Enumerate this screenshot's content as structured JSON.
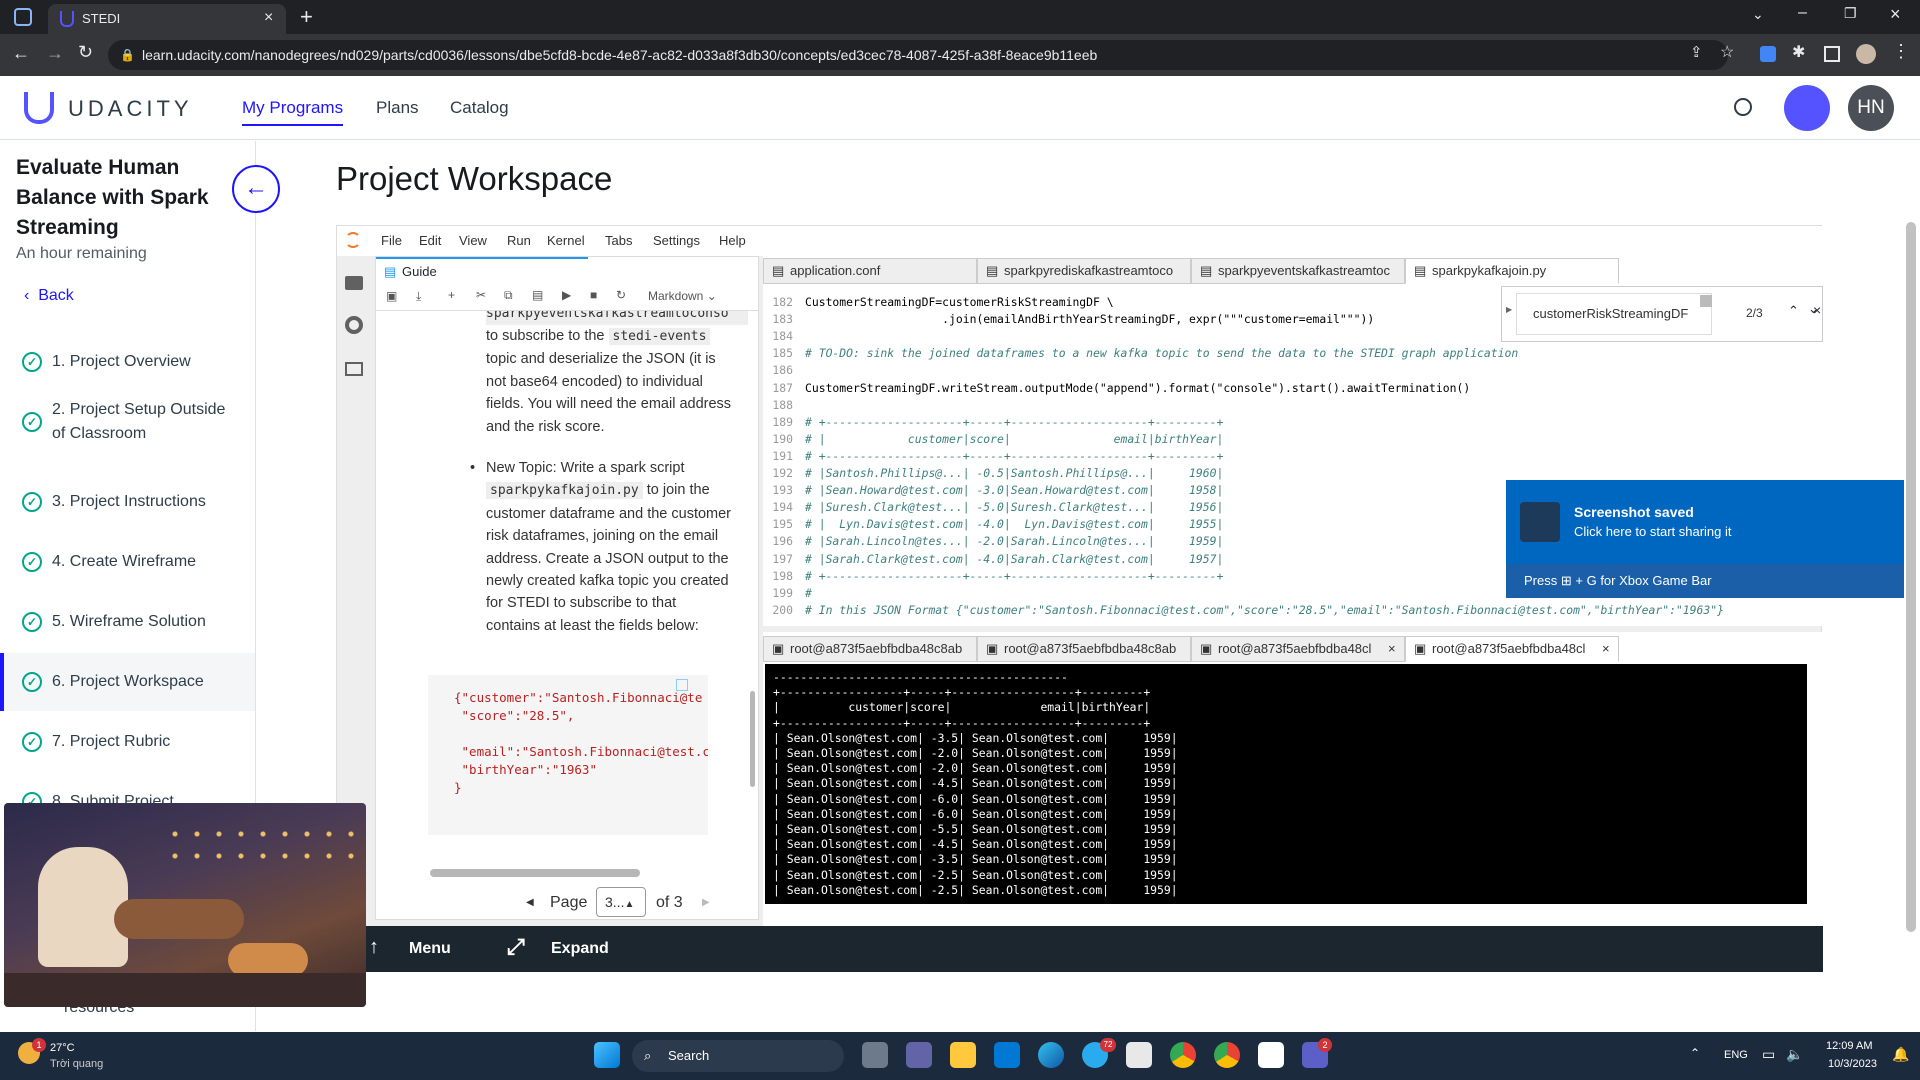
{
  "browser": {
    "tab_title": "STEDI",
    "url": "learn.udacity.com/nanodegrees/nd029/parts/cd0036/lessons/dbe5cfd8-bcde-4e87-ac82-d033a8f3db30/concepts/ed3cec78-4087-425f-a38f-8eace9b11eeb"
  },
  "header": {
    "logo": "UDACITY",
    "nav": [
      "My Programs",
      "Plans",
      "Catalog"
    ],
    "avatar_initials": "HN"
  },
  "sidebar": {
    "course_title": "Evaluate Human Balance with Spark Streaming",
    "time_remaining": "An hour remaining",
    "back": "Back",
    "items": [
      {
        "label": "1. Project Overview"
      },
      {
        "label": "2. Project Setup Outside of Classroom"
      },
      {
        "label": "3. Project Instructions"
      },
      {
        "label": "4. Create Wireframe"
      },
      {
        "label": "5. Wireframe Solution"
      },
      {
        "label": "6. Project Workspace"
      },
      {
        "label": "7. Project Rubric"
      },
      {
        "label": "8. Submit Project"
      }
    ],
    "resources": "resources"
  },
  "main": {
    "title": "Project Workspace"
  },
  "jupyter": {
    "menus": [
      "File",
      "Edit",
      "View",
      "Run",
      "Kernel",
      "Tabs",
      "Settings",
      "Help"
    ],
    "guide_tab": "Guide",
    "cell_type": "Markdown",
    "guide": {
      "line_partial": "sparkpyeventskafkastreamtoconso",
      "p1_a": "to subscribe to the",
      "p1_code": "stedi-events",
      "p1_b": "topic and deserialize the JSON (it is not base64 encoded) to individual fields. You will need the email address and the risk score.",
      "bullet_a": "New Topic: Write a spark script",
      "bullet_code": "sparkpykafkajoin.py",
      "bullet_b": "to join the customer dataframe and the customer risk dataframes, joining on the email address. Create a JSON output to the newly created kafka topic you created for STEDI to subscribe to that contains at least the fields below:",
      "json": "{\"customer\":\"Santosh.Fibonnaci@te\n \"score\":\"28.5\",\n\n \"email\":\"Santosh.Fibonnaci@test.c\n \"birthYear\":\"1963\"\n}"
    },
    "pager": {
      "label": "Page",
      "value": "3...",
      "of": "of 3"
    },
    "editor_tabs": [
      "application.conf",
      "sparkpyrediskafkastreamtoco",
      "sparkpyeventskafkastreamtoc",
      "sparkpykafkajoin.py"
    ],
    "find": {
      "query": "customerRiskStreamingDF",
      "count": "2/3"
    },
    "code_lines": [
      {
        "n": "182",
        "t": "CustomerStreamingDF=customerRiskStreamingDF \\"
      },
      {
        "n": "183",
        "t": "                    .join(emailAndBirthYearStreamingDF, expr(\"\"\"customer=email\"\"\"))"
      },
      {
        "n": "184",
        "t": ""
      },
      {
        "n": "185",
        "t": "# TO-DO: sink the joined dataframes to a new kafka topic to send the data to the STEDI graph application"
      },
      {
        "n": "186",
        "t": ""
      },
      {
        "n": "187",
        "t": "CustomerStreamingDF.writeStream.outputMode(\"append\").format(\"console\").start().awaitTermination()"
      },
      {
        "n": "188",
        "t": ""
      },
      {
        "n": "189",
        "t": "# +--------------------+-----+--------------------+---------+"
      },
      {
        "n": "190",
        "t": "# |            customer|score|               email|birthYear|"
      },
      {
        "n": "191",
        "t": "# +--------------------+-----+--------------------+---------+"
      },
      {
        "n": "192",
        "t": "# |Santosh.Phillips@...| -0.5|Santosh.Phillips@...|     1960|"
      },
      {
        "n": "193",
        "t": "# |Sean.Howard@test.com| -3.0|Sean.Howard@test.com|     1958|"
      },
      {
        "n": "194",
        "t": "# |Suresh.Clark@test...| -5.0|Suresh.Clark@test...|     1956|"
      },
      {
        "n": "195",
        "t": "# |  Lyn.Davis@test.com| -4.0|  Lyn.Davis@test.com|     1955|"
      },
      {
        "n": "196",
        "t": "# |Sarah.Lincoln@tes...| -2.0|Sarah.Lincoln@tes...|     1959|"
      },
      {
        "n": "197",
        "t": "# |Sarah.Clark@test.com| -4.0|Sarah.Clark@test.com|     1957|"
      },
      {
        "n": "198",
        "t": "# +--------------------+-----+--------------------+---------+"
      },
      {
        "n": "199",
        "t": "#"
      },
      {
        "n": "200",
        "t": "# In this JSON Format {\"customer\":\"Santosh.Fibonnaci@test.com\",\"score\":\"28.5\",\"email\":\"Santosh.Fibonnaci@test.com\",\"birthYear\":\"1963\"}"
      }
    ],
    "terminal_tabs": [
      "root@a873f5aebfbdba48c8ab",
      "root@a873f5aebfbdba48c8ab",
      "root@a873f5aebfbdba48cl",
      "root@a873f5aebfbdba48cl"
    ],
    "terminal_output": "-------------------------------------------\n+------------------+-----+------------------+---------+\n|          customer|score|             email|birthYear|\n+------------------+-----+------------------+---------+\n| Sean.Olson@test.com| -3.5| Sean.Olson@test.com|     1959|\n| Sean.Olson@test.com| -2.0| Sean.Olson@test.com|     1959|\n| Sean.Olson@test.com| -2.0| Sean.Olson@test.com|     1959|\n| Sean.Olson@test.com| -4.5| Sean.Olson@test.com|     1959|\n| Sean.Olson@test.com| -6.0| Sean.Olson@test.com|     1959|\n| Sean.Olson@test.com| -6.0| Sean.Olson@test.com|     1959|\n| Sean.Olson@test.com| -5.5| Sean.Olson@test.com|     1959|\n| Sean.Olson@test.com| -4.5| Sean.Olson@test.com|     1959|\n| Sean.Olson@test.com| -3.5| Sean.Olson@test.com|     1959|\n| Sean.Olson@test.com| -2.5| Sean.Olson@test.com|     1959|\n| Sean.Olson@test.com| -2.5| Sean.Olson@test.com|     1959|",
    "bottom": {
      "menu": "Menu",
      "expand": "Expand"
    }
  },
  "toast": {
    "title": "Screenshot saved",
    "subtitle": "Click here to start sharing it",
    "footer_a": "Press",
    "footer_b": "+ G for Xbox Game Bar"
  },
  "taskbar": {
    "weather_temp": "27°C",
    "weather_desc": "Trời quang",
    "weather_badge": "1",
    "search": "Search",
    "lang": "ENG",
    "time": "12:09 AM",
    "date": "10/3/2023",
    "badges": [
      "72",
      "2"
    ]
  },
  "colors": {
    "accent": "#02b3e4",
    "brand_purple": "#5553ff",
    "check_green": "#02a78b",
    "nav_active": "#2015ff"
  }
}
